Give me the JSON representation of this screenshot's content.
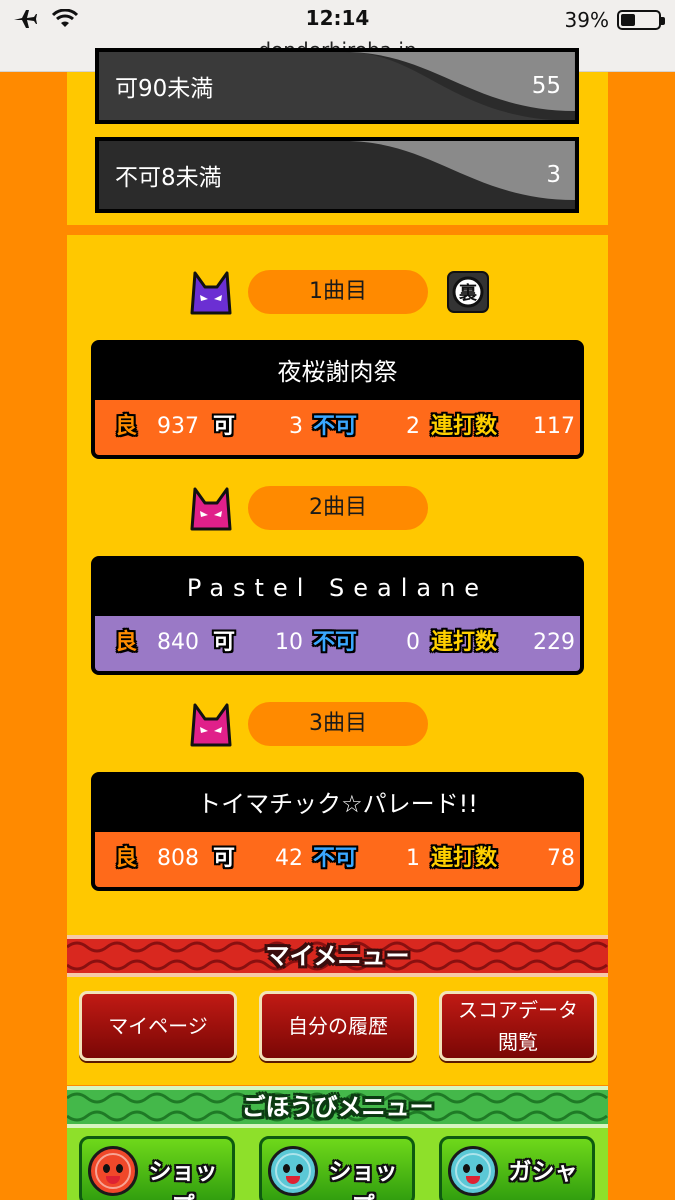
{
  "status_bar": {
    "time": "12:14",
    "battery": "39%",
    "battery_level": 0.39,
    "url": "donderhiroba.jp"
  },
  "stats": [
    {
      "label": "可90未満",
      "value": "55"
    },
    {
      "label": "不可8未満",
      "value": "3"
    }
  ],
  "judge_labels": {
    "ryo": "良",
    "ka": "可",
    "fuka": "不可",
    "renda": "連打数"
  },
  "songs": [
    {
      "order": "1曲目",
      "title": "夜桜謝肉祭",
      "difficulty_icon": "oni-purple-icon",
      "ura": true,
      "ura_label": "裏",
      "row_color": "#ff6a1a",
      "ryo": "937",
      "ka": "3",
      "fuka": "2",
      "renda": "117"
    },
    {
      "order": "2曲目",
      "title": "Pastel Sealane",
      "difficulty_icon": "oni-pink-icon",
      "ura": false,
      "row_color": "#9a79c6",
      "ryo": "840",
      "ka": "10",
      "fuka": "0",
      "renda": "229"
    },
    {
      "order": "3曲目",
      "title": "トイマチック☆パレード!!",
      "difficulty_icon": "oni-pink-icon",
      "ura": false,
      "row_color": "#ff6a1a",
      "ryo": "808",
      "ka": "42",
      "fuka": "1",
      "renda": "78"
    }
  ],
  "my_menu": {
    "title": "マイメニュー",
    "buttons": [
      "マイページ",
      "自分の履歴",
      "スコアデータ\n閲覧"
    ]
  },
  "reward_menu": {
    "title": "ごほうびメニュー",
    "buttons": [
      {
        "label": "ショップ",
        "icon": "don-coin-icon"
      },
      {
        "label": "ショップ",
        "icon": "ka-coin-icon"
      },
      {
        "label": "ガシャ",
        "icon": "ka-coin-icon"
      }
    ]
  },
  "colors": {
    "background": "#ff8a00",
    "panel": "#ffc800",
    "accent_orange": "#ff6a1a",
    "accent_purple": "#9a79c6",
    "menu_red": "#c11a14",
    "menu_green": "#8ee02a"
  }
}
